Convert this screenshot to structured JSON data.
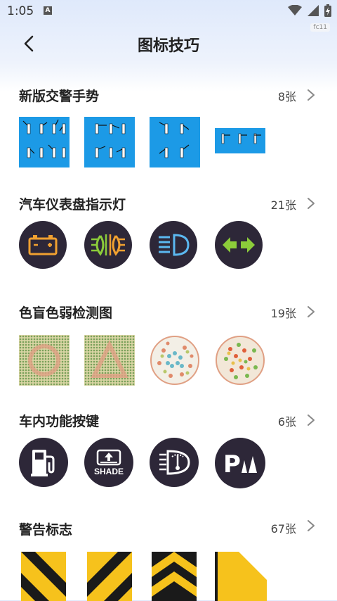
{
  "status": {
    "time": "1:05",
    "notif_letter": "A",
    "badge": "fc11"
  },
  "header": {
    "title": "图标技巧"
  },
  "sections": [
    {
      "title": "新版交警手势",
      "count": "8张"
    },
    {
      "title": "汽车仪表盘指示灯",
      "count": "21张"
    },
    {
      "title": "色盲色弱检测图",
      "count": "19张"
    },
    {
      "title": "车内功能按键",
      "count": "6张"
    },
    {
      "title": "警告标志",
      "count": "67张"
    }
  ],
  "icons": {
    "police": [
      "police-gesture-image-1",
      "police-gesture-image-2",
      "police-gesture-image-3",
      "police-gesture-image-4"
    ],
    "dashboard": [
      "battery-icon",
      "fog-lights-icon",
      "high-beam-icon",
      "turn-signal-icon"
    ],
    "colorblind": [
      "dot-pattern-circle",
      "dot-pattern-triangle",
      "ishihara-plate-1",
      "ishihara-plate-2"
    ],
    "car_buttons": [
      "fuel-icon",
      "shade-icon",
      "windshield-icon",
      "parking-sensor-icon"
    ],
    "warning": [
      "chevron-sign-1",
      "chevron-sign-2",
      "chevron-sign-3",
      "stripe-sign-4"
    ]
  },
  "labels": {
    "shade_text": "SHADE",
    "parking_letter": "P"
  },
  "colors": {
    "gesture_bg": "#1c9ae6",
    "icon_dark": "#2d2738",
    "warning_yellow": "#f6c21c"
  }
}
